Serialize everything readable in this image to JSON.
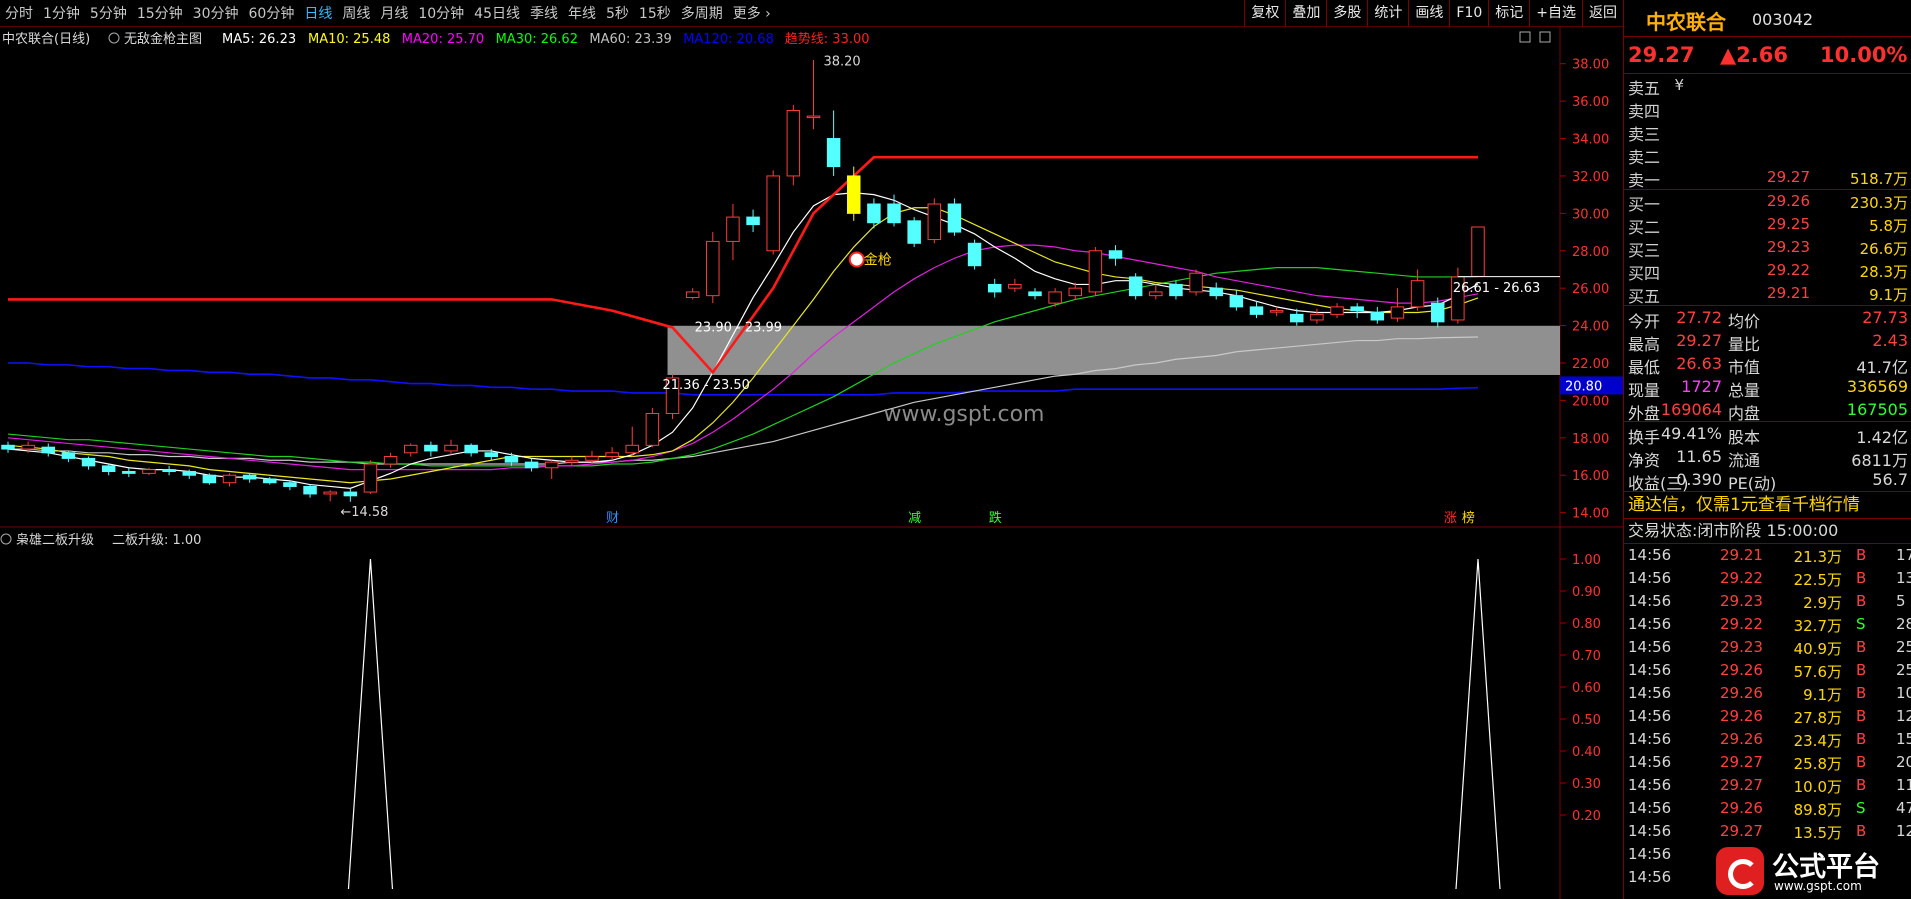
{
  "toolbar": {
    "periods": [
      "分时",
      "1分钟",
      "5分钟",
      "15分钟",
      "30分钟",
      "60分钟",
      "日线",
      "周线",
      "月线",
      "10分钟",
      "45日线",
      "季线",
      "年线",
      "5秒",
      "15秒",
      "多周期",
      "更多"
    ],
    "active_period": "日线",
    "tools": [
      "复权",
      "叠加",
      "多股",
      "统计",
      "画线",
      "F10",
      "标记",
      "+自选",
      "返回"
    ]
  },
  "main": {
    "title": "中农联合(日线)",
    "indicator_name": "无敌金枪主图",
    "ma": [
      {
        "label": "MA5: 26.23",
        "color": "#ffffff"
      },
      {
        "label": "MA10: 25.48",
        "color": "#ffff00"
      },
      {
        "label": "MA20: 25.70",
        "color": "#ff00ff"
      },
      {
        "label": "MA30: 26.62",
        "color": "#00ff00"
      },
      {
        "label": "MA60: 23.39",
        "color": "#c0c0c0"
      },
      {
        "label": "MA120: 20.68",
        "color": "#0000ff"
      },
      {
        "label": "趋势线: 33.00",
        "color": "#ff2020"
      }
    ],
    "annotations": {
      "high": "38.20",
      "low": "←14.58",
      "zone_top": "23.90 - 23.99",
      "zone_bottom": "21.36 - 23.50",
      "right_range": "26.61 - 26.63",
      "signal": "金枪",
      "watermark": "www.gspt.com",
      "current_axis_label": "20.80"
    },
    "markers": [
      "财",
      "减",
      "跌",
      "涨",
      "榜"
    ],
    "price_ticks": [
      "38.00",
      "36.00",
      "34.00",
      "32.00",
      "30.00",
      "28.00",
      "26.00",
      "24.00",
      "22.00",
      "20.00",
      "18.00",
      "16.00",
      "14.00"
    ]
  },
  "sub": {
    "title": "枭雄二板升级",
    "value_label": "二板升级: 1.00",
    "ticks": [
      "1.00",
      "0.90",
      "0.80",
      "0.70",
      "0.60",
      "0.50",
      "0.40",
      "0.30",
      "0.20"
    ]
  },
  "chart_data": {
    "type": "candlestick",
    "ylim": [
      13.5,
      39
    ],
    "candles": [
      [
        17.6,
        17.4,
        17.8,
        17.2
      ],
      [
        17.4,
        17.6,
        17.8,
        17.2
      ],
      [
        17.5,
        17.2,
        17.7,
        17.0
      ],
      [
        17.2,
        16.9,
        17.3,
        16.7
      ],
      [
        16.9,
        16.5,
        17.0,
        16.3
      ],
      [
        16.5,
        16.2,
        16.6,
        16.0
      ],
      [
        16.2,
        16.1,
        16.4,
        15.9
      ],
      [
        16.1,
        16.3,
        16.4,
        16.0
      ],
      [
        16.3,
        16.2,
        16.5,
        16.0
      ],
      [
        16.2,
        16.0,
        16.3,
        15.8
      ],
      [
        16.0,
        15.6,
        16.1,
        15.5
      ],
      [
        15.6,
        16.0,
        16.1,
        15.4
      ],
      [
        16.0,
        15.8,
        16.1,
        15.6
      ],
      [
        15.8,
        15.6,
        15.9,
        15.5
      ],
      [
        15.6,
        15.4,
        15.7,
        15.2
      ],
      [
        15.4,
        15.0,
        15.5,
        14.8
      ],
      [
        15.0,
        15.1,
        15.2,
        14.6
      ],
      [
        15.1,
        14.9,
        15.3,
        14.58
      ],
      [
        15.1,
        16.6,
        16.8,
        15.0
      ],
      [
        16.6,
        17.0,
        17.2,
        16.4
      ],
      [
        17.2,
        17.6,
        17.7,
        17.0
      ],
      [
        17.6,
        17.3,
        17.8,
        17.0
      ],
      [
        17.3,
        17.6,
        17.9,
        17.1
      ],
      [
        17.6,
        17.2,
        17.7,
        17.0
      ],
      [
        17.2,
        17.0,
        17.4,
        16.8
      ],
      [
        17.0,
        16.7,
        17.2,
        16.5
      ],
      [
        16.7,
        16.4,
        16.9,
        16.2
      ],
      [
        16.4,
        16.7,
        16.8,
        15.8
      ],
      [
        16.7,
        16.8,
        17.0,
        16.5
      ],
      [
        16.8,
        17.0,
        17.3,
        16.6
      ],
      [
        17.0,
        17.2,
        17.5,
        16.8
      ],
      [
        17.2,
        17.6,
        18.6,
        17.0
      ],
      [
        17.6,
        19.3,
        19.6,
        17.5
      ],
      [
        19.3,
        21.2,
        21.4,
        19.0
      ],
      [
        25.5,
        25.8,
        26.0,
        25.4
      ],
      [
        25.6,
        28.5,
        29.0,
        25.2
      ],
      [
        28.5,
        29.8,
        30.5,
        27.5
      ],
      [
        29.8,
        29.4,
        30.2,
        29.0
      ],
      [
        28.0,
        32.0,
        32.3,
        27.8
      ],
      [
        32.0,
        35.5,
        35.8,
        31.5
      ],
      [
        35.2,
        35.2,
        38.2,
        34.5
      ],
      [
        34.0,
        32.5,
        35.5,
        32.0
      ],
      [
        32.0,
        30.0,
        32.5,
        29.6
      ],
      [
        30.5,
        29.5,
        30.8,
        29.2
      ],
      [
        30.5,
        29.5,
        31.0,
        29.3
      ],
      [
        29.6,
        28.4,
        29.8,
        28.2
      ],
      [
        28.6,
        30.5,
        30.8,
        28.4
      ],
      [
        30.5,
        29.0,
        30.8,
        28.8
      ],
      [
        28.4,
        27.2,
        28.6,
        27.0
      ],
      [
        26.2,
        25.8,
        26.5,
        25.5
      ],
      [
        26.0,
        26.2,
        26.5,
        25.8
      ],
      [
        25.8,
        25.6,
        26.0,
        25.4
      ],
      [
        25.2,
        25.8,
        26.0,
        25.0
      ],
      [
        25.6,
        26.0,
        26.3,
        25.4
      ],
      [
        25.8,
        28.0,
        28.2,
        25.6
      ],
      [
        28.0,
        27.6,
        28.3,
        27.2
      ],
      [
        26.6,
        25.6,
        26.8,
        25.4
      ],
      [
        25.6,
        25.8,
        26.2,
        25.4
      ],
      [
        26.2,
        25.6,
        26.4,
        25.4
      ],
      [
        25.8,
        26.8,
        27.0,
        25.6
      ],
      [
        26.0,
        25.6,
        26.3,
        25.4
      ],
      [
        25.6,
        25.0,
        25.9,
        24.8
      ],
      [
        25.0,
        24.6,
        25.3,
        24.4
      ],
      [
        24.8,
        24.8,
        25.0,
        24.5
      ],
      [
        24.6,
        24.2,
        24.9,
        24.0
      ],
      [
        24.3,
        24.6,
        24.9,
        24.1
      ],
      [
        24.6,
        25.0,
        25.2,
        24.4
      ],
      [
        25.0,
        24.8,
        25.2,
        24.4
      ],
      [
        24.7,
        24.3,
        25.0,
        24.1
      ],
      [
        24.4,
        25.0,
        26.0,
        24.2
      ],
      [
        25.0,
        26.4,
        27.0,
        24.8
      ],
      [
        25.2,
        24.2,
        25.5,
        23.9
      ],
      [
        24.3,
        26.6,
        27.1,
        24.1
      ],
      [
        26.63,
        29.27,
        29.27,
        26.63
      ]
    ],
    "ma5": [
      17.4,
      17.3,
      17.2,
      17.0,
      16.8,
      16.6,
      16.4,
      16.3,
      16.3,
      16.2,
      16.0,
      15.9,
      15.9,
      15.8,
      15.7,
      15.5,
      15.4,
      15.3,
      15.7,
      16.1,
      16.6,
      16.9,
      17.1,
      17.3,
      17.3,
      17.1,
      16.9,
      16.8,
      16.7,
      16.7,
      16.8,
      17.1,
      17.6,
      18.3,
      19.6,
      21.5,
      23.5,
      25.5,
      27.2,
      29.0,
      30.4,
      31.0,
      31.1,
      31.0,
      30.7,
      30.2,
      29.8,
      29.4,
      28.9,
      28.2,
      27.6,
      26.9,
      26.5,
      26.2,
      26.2,
      26.4,
      26.4,
      26.2,
      26.0,
      25.9,
      25.8,
      25.6,
      25.3,
      25.0,
      24.8,
      24.7,
      24.7,
      24.7,
      24.7,
      24.8,
      25.0,
      25.1,
      25.6,
      26.23
    ],
    "ma10": [
      17.6,
      17.5,
      17.4,
      17.2,
      17.1,
      17.0,
      16.8,
      16.7,
      16.6,
      16.5,
      16.3,
      16.2,
      16.1,
      16.0,
      15.9,
      15.8,
      15.7,
      15.6,
      15.7,
      15.8,
      16.0,
      16.2,
      16.4,
      16.6,
      16.8,
      17.0,
      17.0,
      17.0,
      17.0,
      17.0,
      17.0,
      17.0,
      17.1,
      17.3,
      17.9,
      18.8,
      19.9,
      21.2,
      22.6,
      24.0,
      25.4,
      26.9,
      28.2,
      29.3,
      30.0,
      30.3,
      30.3,
      29.9,
      29.4,
      28.9,
      28.4,
      27.9,
      27.4,
      27.1,
      26.8,
      26.6,
      26.5,
      26.3,
      26.2,
      26.1,
      26.0,
      25.9,
      25.7,
      25.5,
      25.3,
      25.1,
      24.9,
      24.8,
      24.7,
      24.7,
      24.7,
      24.8,
      25.1,
      25.48
    ],
    "ma20": [
      18.0,
      17.9,
      17.8,
      17.7,
      17.6,
      17.5,
      17.4,
      17.3,
      17.2,
      17.1,
      17.0,
      16.9,
      16.8,
      16.7,
      16.6,
      16.5,
      16.4,
      16.3,
      16.3,
      16.3,
      16.3,
      16.3,
      16.3,
      16.3,
      16.3,
      16.4,
      16.4,
      16.5,
      16.5,
      16.6,
      16.7,
      16.8,
      17.0,
      17.3,
      17.7,
      18.3,
      19.0,
      19.8,
      20.6,
      21.5,
      22.5,
      23.4,
      24.2,
      25.0,
      25.8,
      26.5,
      27.1,
      27.6,
      28.0,
      28.2,
      28.3,
      28.3,
      28.2,
      28.0,
      27.9,
      27.7,
      27.5,
      27.3,
      27.1,
      26.9,
      26.6,
      26.4,
      26.2,
      26.0,
      25.8,
      25.6,
      25.5,
      25.4,
      25.3,
      25.2,
      25.2,
      25.3,
      25.5,
      25.7
    ],
    "ma30": [
      18.2,
      18.1,
      18.0,
      17.9,
      17.9,
      17.8,
      17.7,
      17.6,
      17.5,
      17.4,
      17.3,
      17.2,
      17.1,
      17.0,
      17.0,
      16.9,
      16.8,
      16.7,
      16.7,
      16.6,
      16.6,
      16.5,
      16.5,
      16.5,
      16.5,
      16.5,
      16.5,
      16.5,
      16.5,
      16.5,
      16.6,
      16.6,
      16.7,
      16.9,
      17.1,
      17.4,
      17.8,
      18.2,
      18.7,
      19.2,
      19.7,
      20.2,
      20.8,
      21.4,
      22.0,
      22.5,
      23.0,
      23.4,
      23.8,
      24.2,
      24.5,
      24.8,
      25.1,
      25.4,
      25.6,
      25.8,
      26.0,
      26.2,
      26.4,
      26.6,
      26.8,
      26.9,
      27.0,
      27.1,
      27.1,
      27.1,
      27.0,
      26.9,
      26.8,
      26.7,
      26.6,
      26.6,
      26.6,
      26.62
    ],
    "ma60": [
      17.4,
      17.4,
      17.3,
      17.3,
      17.2,
      17.2,
      17.1,
      17.1,
      17.0,
      17.0,
      16.9,
      16.9,
      16.9,
      16.8,
      16.8,
      16.7,
      16.7,
      16.7,
      16.6,
      16.6,
      16.6,
      16.6,
      16.6,
      16.6,
      16.6,
      16.6,
      16.6,
      16.6,
      16.7,
      16.7,
      16.7,
      16.8,
      16.8,
      16.9,
      17.0,
      17.2,
      17.4,
      17.6,
      17.8,
      18.1,
      18.4,
      18.7,
      19.0,
      19.3,
      19.6,
      19.9,
      20.1,
      20.3,
      20.5,
      20.7,
      20.9,
      21.1,
      21.3,
      21.4,
      21.6,
      21.7,
      21.9,
      22.0,
      22.2,
      22.3,
      22.4,
      22.6,
      22.7,
      22.8,
      22.9,
      23.0,
      23.1,
      23.2,
      23.2,
      23.3,
      23.3,
      23.35,
      23.37,
      23.39
    ],
    "ma120": [
      22.0,
      22.0,
      21.9,
      21.9,
      21.8,
      21.8,
      21.7,
      21.7,
      21.6,
      21.6,
      21.5,
      21.5,
      21.4,
      21.4,
      21.3,
      21.2,
      21.2,
      21.1,
      21.1,
      21.0,
      20.9,
      20.9,
      20.8,
      20.8,
      20.7,
      20.7,
      20.6,
      20.6,
      20.5,
      20.5,
      20.5,
      20.4,
      20.4,
      20.4,
      20.3,
      20.3,
      20.3,
      20.3,
      20.3,
      20.3,
      20.3,
      20.3,
      20.3,
      20.3,
      20.4,
      20.4,
      20.4,
      20.4,
      20.5,
      20.5,
      20.5,
      20.5,
      20.5,
      20.6,
      20.6,
      20.6,
      20.6,
      20.6,
      20.6,
      20.6,
      20.6,
      20.6,
      20.6,
      20.6,
      20.6,
      20.6,
      20.6,
      20.6,
      20.6,
      20.6,
      20.6,
      20.6,
      20.65,
      20.68
    ],
    "trend_line": [
      {
        "i": 0,
        "v": 25.4
      },
      {
        "i": 27,
        "v": 25.4
      },
      {
        "i": 30,
        "v": 24.8
      },
      {
        "i": 33,
        "v": 23.9
      },
      {
        "i": 35,
        "v": 21.5
      },
      {
        "i": 38,
        "v": 26.0
      },
      {
        "i": 40,
        "v": 30.0
      },
      {
        "i": 43,
        "v": 33.0
      },
      {
        "i": 73,
        "v": 33.0
      }
    ],
    "zone": {
      "top": 23.99,
      "bottom": 21.36,
      "start_index": 33
    },
    "sub_series": {
      "spikes": [
        {
          "i": 18,
          "v": 1.0
        },
        {
          "i": 73,
          "v": 1.0
        }
      ],
      "ylim": [
        0,
        1.05
      ]
    }
  },
  "orderbook": {
    "name": "中农联合",
    "code": "003042",
    "last": "29.27",
    "change": "▲2.66",
    "pct": "10.00%",
    "asks": [
      {
        "label": "卖五",
        "price": "¥",
        "vol": ""
      },
      {
        "label": "卖四",
        "price": "",
        "vol": ""
      },
      {
        "label": "卖三",
        "price": "",
        "vol": ""
      },
      {
        "label": "卖二",
        "price": "",
        "vol": ""
      },
      {
        "label": "卖一",
        "price": "29.27",
        "vol": "518.7万"
      }
    ],
    "bids": [
      {
        "label": "买一",
        "price": "29.26",
        "vol": "230.3万"
      },
      {
        "label": "买二",
        "price": "29.25",
        "vol": "5.8万"
      },
      {
        "label": "买三",
        "price": "29.23",
        "vol": "26.6万"
      },
      {
        "label": "买四",
        "price": "29.22",
        "vol": "28.3万"
      },
      {
        "label": "买五",
        "price": "29.21",
        "vol": "9.1万"
      }
    ],
    "stats": [
      {
        "l1": "今开",
        "v1": "27.72",
        "c1": "#ff4040",
        "l2": "均价",
        "v2": "27.73",
        "c2": "#ff4040"
      },
      {
        "l1": "最高",
        "v1": "29.27",
        "c1": "#ff4040",
        "l2": "量比",
        "v2": "2.43",
        "c2": "#ff4040"
      },
      {
        "l1": "最低",
        "v1": "26.63",
        "c1": "#ff4040",
        "l2": "市值",
        "v2": "41.7亿",
        "c2": "#d8d8d8"
      },
      {
        "l1": "现量",
        "v1": "1727",
        "c1": "#ff40ff",
        "l2": "总量",
        "v2": "336569",
        "c2": "#ffd700"
      },
      {
        "l1": "外盘",
        "v1": "169064",
        "c1": "#ff4040",
        "l2": "内盘",
        "v2": "167505",
        "c2": "#30ff30"
      },
      {
        "l1": "换手",
        "v1": "49.41%",
        "c1": "#d8d8d8",
        "l2": "股本",
        "v2": "1.42亿",
        "c2": "#d8d8d8"
      },
      {
        "l1": "净资",
        "v1": "11.65",
        "c1": "#d8d8d8",
        "l2": "流通",
        "v2": "6811万",
        "c2": "#d8d8d8"
      },
      {
        "l1": "收益(三)",
        "v1": "0.390",
        "c1": "#d8d8d8",
        "l2": "PE(动)",
        "v2": "56.7",
        "c2": "#d8d8d8"
      }
    ],
    "notice": "通达信，仅需1元查看千档行情",
    "trade_state": "交易状态:闭市阶段 15:00:00",
    "ticks": [
      {
        "t": "14:56",
        "p": "29.21",
        "v": "21.3万",
        "s": "B",
        "n": "17"
      },
      {
        "t": "14:56",
        "p": "29.22",
        "v": "22.5万",
        "s": "B",
        "n": "13"
      },
      {
        "t": "14:56",
        "p": "29.23",
        "v": "2.9万",
        "s": "B",
        "n": "5"
      },
      {
        "t": "14:56",
        "p": "29.22",
        "v": "32.7万",
        "s": "S",
        "n": "28"
      },
      {
        "t": "14:56",
        "p": "29.23",
        "v": "40.9万",
        "s": "B",
        "n": "25"
      },
      {
        "t": "14:56",
        "p": "29.26",
        "v": "57.6万",
        "s": "B",
        "n": "25"
      },
      {
        "t": "14:56",
        "p": "29.26",
        "v": "9.1万",
        "s": "B",
        "n": "10"
      },
      {
        "t": "14:56",
        "p": "29.26",
        "v": "27.8万",
        "s": "B",
        "n": "12"
      },
      {
        "t": "14:56",
        "p": "29.26",
        "v": "23.4万",
        "s": "B",
        "n": "15"
      },
      {
        "t": "14:56",
        "p": "29.27",
        "v": "25.8万",
        "s": "B",
        "n": "20"
      },
      {
        "t": "14:56",
        "p": "29.27",
        "v": "10.0万",
        "s": "B",
        "n": "11"
      },
      {
        "t": "14:56",
        "p": "29.26",
        "v": "89.8万",
        "s": "S",
        "n": "47"
      },
      {
        "t": "14:56",
        "p": "29.27",
        "v": "13.5万",
        "s": "B",
        "n": "12"
      },
      {
        "t": "14:56",
        "p": "",
        "v": "",
        "s": "",
        "n": ""
      },
      {
        "t": "14:56",
        "p": "",
        "v": "",
        "s": "",
        "n": ""
      }
    ]
  },
  "logo": {
    "big": "公式平台",
    "small": "www.gspt.com"
  }
}
